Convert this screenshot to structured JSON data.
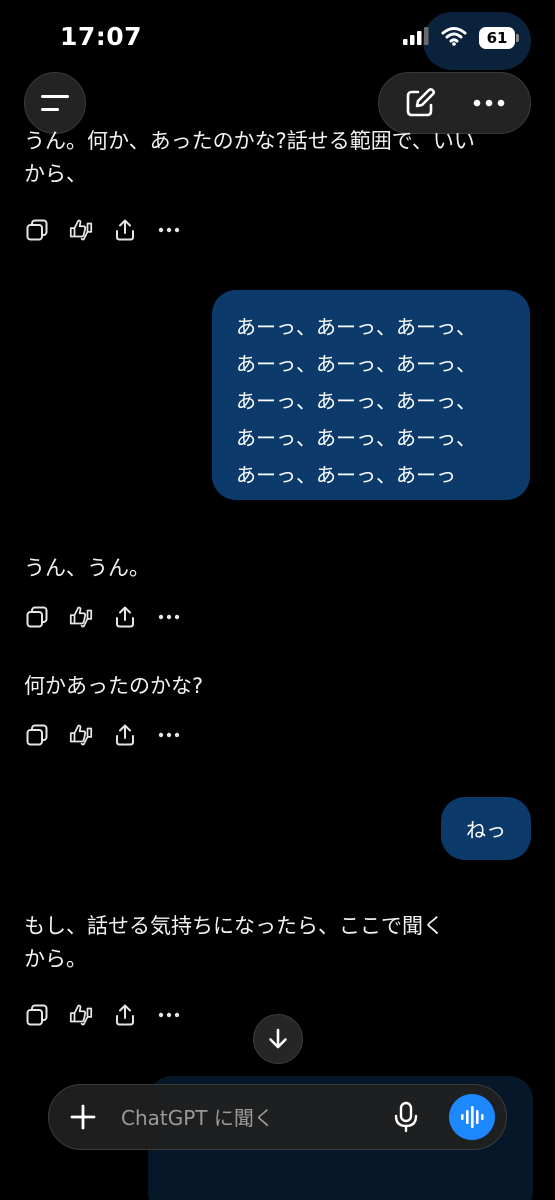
{
  "status_bar": {
    "time": "17:07",
    "battery": "61",
    "icons": [
      "cellular-icon",
      "wifi-icon",
      "battery-icon"
    ]
  },
  "header": {
    "icons": [
      "menu-icon",
      "new-chat-icon",
      "more-icon"
    ]
  },
  "colors": {
    "background": "#000000",
    "user_bubble": "#0b3a6b",
    "accent": "#1e88ff",
    "text": "#f2f2f2"
  },
  "conversation": {
    "assistant_1": {
      "line1": "うん。何か、あったのかな?話せる範囲で、いい",
      "line2": "から、"
    },
    "user_1": {
      "lines": [
        "あーっ、あーっ、あーっ、",
        "あーっ、あーっ、あーっ、",
        "あーっ、あーっ、あーっ、",
        "あーっ、あーっ、あーっ、",
        "あーっ、あーっ、あーっ"
      ]
    },
    "assistant_2": {
      "text": "うん、うん。"
    },
    "assistant_3": {
      "text": "何かあったのかな?"
    },
    "user_2": {
      "text": "ねっ"
    },
    "assistant_4": {
      "line1": "もし、話せる気持ちになったら、ここで聞く",
      "line2": "から。"
    }
  },
  "message_actions": [
    "copy-icon",
    "feedback-icon",
    "share-icon",
    "more-icon"
  ],
  "composer": {
    "placeholder": "ChatGPT に聞く",
    "icons": [
      "plus-icon",
      "mic-icon",
      "voice-mode-icon"
    ]
  }
}
